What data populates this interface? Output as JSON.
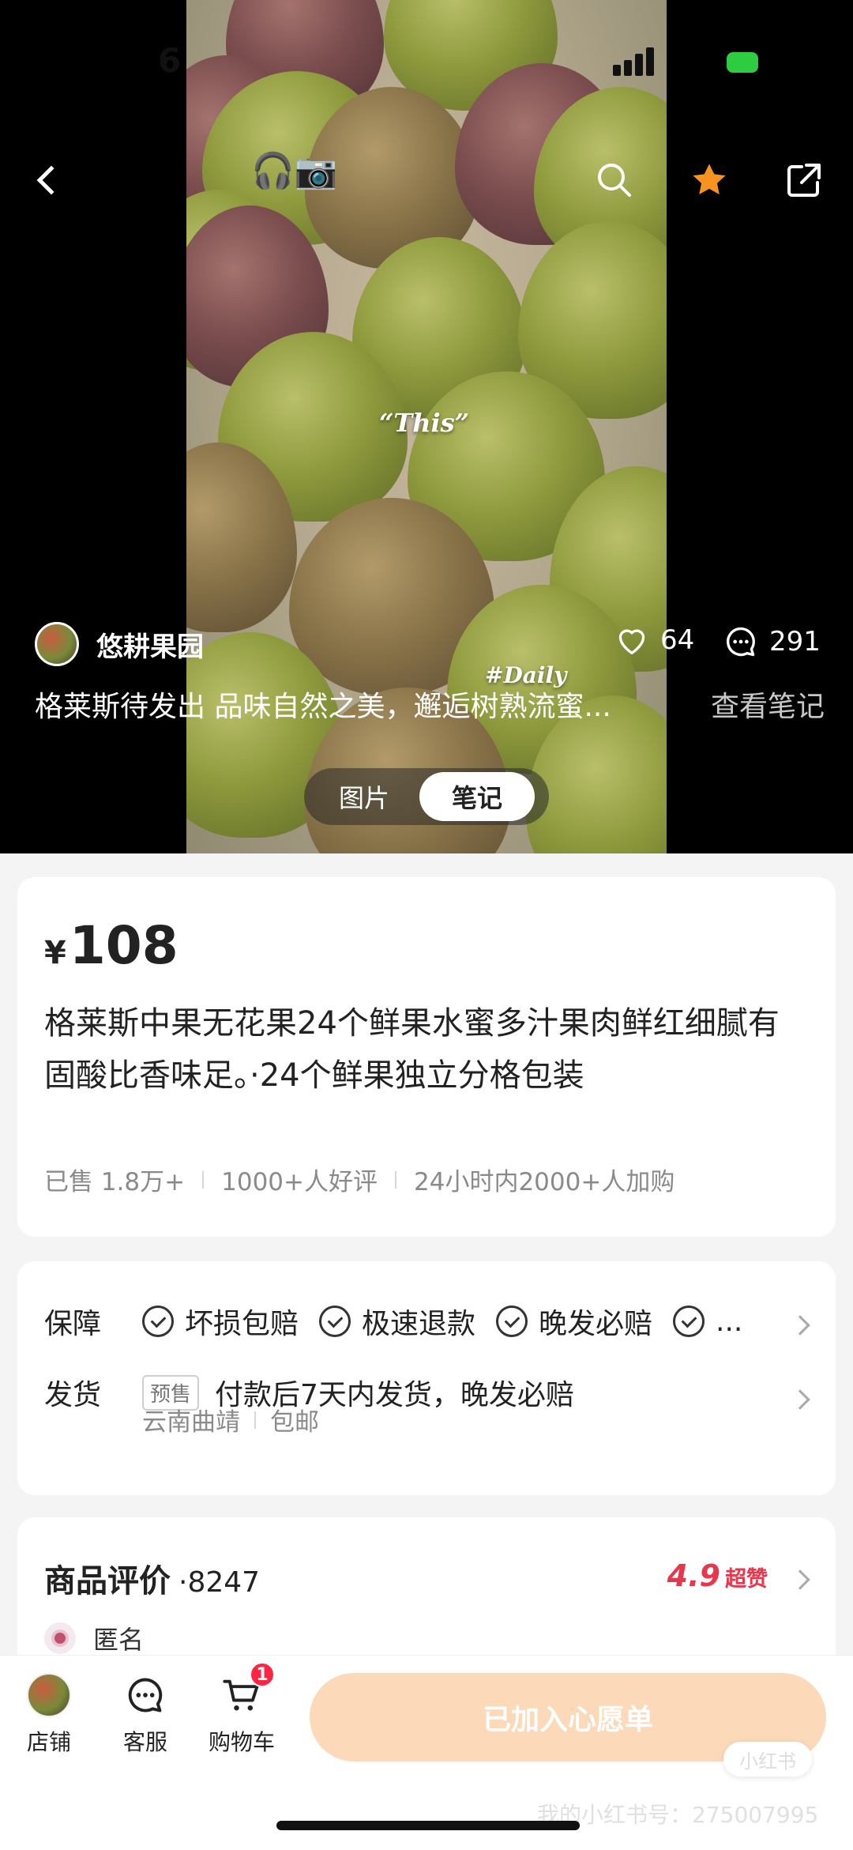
{
  "status_bar": {
    "time": "6"
  },
  "header": {
    "back_icon": "chevron-left-icon",
    "search_icon": "search-icon",
    "favorite_icon": "star-icon",
    "favorite_color": "#f7931e",
    "share_icon": "share-icon"
  },
  "video": {
    "overlay_text_1": "“This”",
    "overlay_text_2": "#Daily"
  },
  "post": {
    "author": "悠耕果园",
    "likes": "64",
    "comments": "291",
    "caption": "格莱斯待发出 品味自然之美，邂逅树熟流蜜...",
    "view_note": "查看笔记"
  },
  "segment": {
    "option_1": "图片",
    "option_2": "笔记"
  },
  "product": {
    "currency": "¥",
    "price": "108",
    "title": "格莱斯中果无花果24个鲜果水蜜多汁果肉鲜红细腻有固酸比香味足。·24个鲜果独立分格包装",
    "sold": "已售 1.8万+",
    "good_reviews": "1000+人好评",
    "cart_adds": "24小时内2000+人加购"
  },
  "service": {
    "guarantee_label": "保障",
    "guarantees": [
      "坏损包赔",
      "极速退款",
      "晚发必赔",
      "..."
    ],
    "shipping_label": "发货",
    "presale_tag": "预售",
    "shipping_text": "付款后7天内发货，晚发必赔",
    "origin": "云南曲靖",
    "shipping_fee": "包邮"
  },
  "reviews": {
    "title": "商品评价",
    "count": "·8247",
    "score": "4.9",
    "score_word": "超赞",
    "first_reviewer": "匿名"
  },
  "bottom_bar": {
    "shop_label": "店铺",
    "service_label": "客服",
    "cart_label": "购物车",
    "cart_badge": "1",
    "wishlist_button": "已加入心愿单",
    "wishlist_color": "#fcd9b8"
  },
  "watermark": "我的小红书号：275007995"
}
